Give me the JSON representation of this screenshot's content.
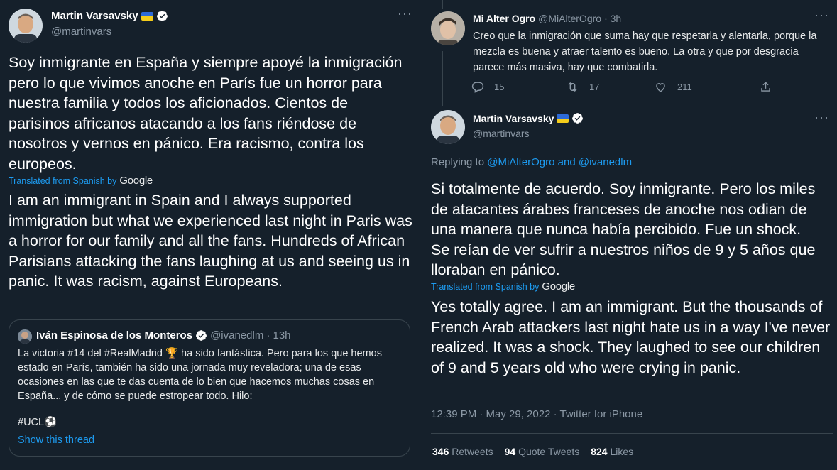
{
  "left_tweet": {
    "author_name": "Martin Varsavsky",
    "author_handle": "@martinvars",
    "original_text": "Soy inmigrante en España y siempre apoyé la inmigración pero lo que vivimos anoche en París fue un horror para nuestra familia y todos los aficionados. Cientos de parisinos africanos atacando a los fans riéndose de nosotros y vernos en pánico. Era racismo, contra los europeos.",
    "translated_label": "Translated from Spanish by",
    "translation_provider": "Google",
    "translated_text": "I am an immigrant in Spain and I always supported immigration but what we experienced last night in Paris was a horror for our family and all the fans. Hundreds of African Parisians attacking the fans laughing at us and seeing us in panic. It was racism, against Europeans.",
    "quote": {
      "author_name": "Iván Espinosa de los Monteros",
      "author_handle": "@ivanedlm",
      "time": "· 13h",
      "text": "La victoria #14 del #RealMadrid 🏆 ha sido fantástica. Pero para los que hemos estado en París, también ha sido una jornada muy reveladora; una de esas ocasiones en las que te das cuenta de lo bien que hacemos muchas cosas en España... y de cómo se puede estropear todo. Hilo:",
      "hashtag": "#UCL⚽",
      "show_thread": "Show this thread"
    }
  },
  "right_panel": {
    "reply": {
      "author_name": "Mi Alter Ogro",
      "author_handle": "@MiAlterOgro",
      "time": "· 3h",
      "text": "Creo que la inmigración que suma hay que respetarla y alentarla, porque la mezcla es buena y atraer talento es bueno. La otra y que por desgracia parece más masiva, hay que combatirla.",
      "reply_count": "15",
      "retweet_count": "17",
      "like_count": "211"
    },
    "main": {
      "author_name": "Martin Varsavsky",
      "author_handle": "@martinvars",
      "replying_prefix": "Replying to",
      "replying_user1": "@MiAlterOgro",
      "replying_and": "and",
      "replying_user2": "@ivanedlm",
      "original_text": "Si totalmente de acuerdo. Soy inmigrante. Pero los miles de atacantes árabes franceses de anoche nos odian de una manera que nunca había percibido. Fue un shock. Se reían de ver sufrir a nuestros niños de 9 y 5 años que lloraban en pánico.",
      "translated_label": "Translated from Spanish by",
      "translation_provider": "Google",
      "translated_text": "Yes totally agree. I am an immigrant. But the thousands of French Arab attackers last night hate us in a way I've never realized. It was a shock. They laughed to see our children of 9 and 5 years old who were crying in panic.",
      "timestamp": "12:39 PM · May 29, 2022 · Twitter for iPhone",
      "retweets_num": "346",
      "retweets_label": "Retweets",
      "quotes_num": "94",
      "quotes_label": "Quote Tweets",
      "likes_num": "824",
      "likes_label": "Likes"
    }
  },
  "colors": {
    "background": "#15202b",
    "accent": "#1d9bf0",
    "muted": "#8b98a5",
    "border": "#38444d"
  }
}
